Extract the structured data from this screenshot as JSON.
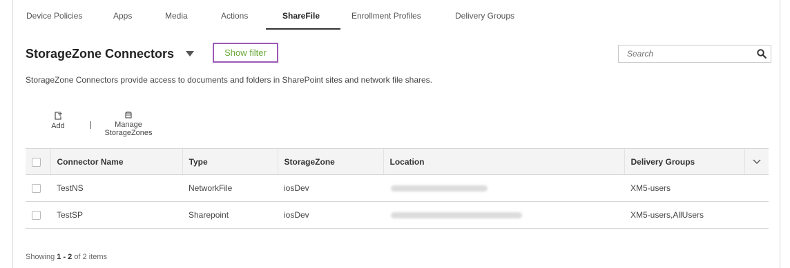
{
  "tabs": [
    {
      "label": "Device Policies",
      "active": false
    },
    {
      "label": "Apps",
      "active": false
    },
    {
      "label": "Media",
      "active": false
    },
    {
      "label": "Actions",
      "active": false
    },
    {
      "label": "ShareFile",
      "active": true
    },
    {
      "label": "Enrollment Profiles",
      "active": false
    },
    {
      "label": "Delivery Groups",
      "active": false
    }
  ],
  "header": {
    "title": "StorageZone Connectors",
    "show_filter_label": "Show filter",
    "search_placeholder": "Search"
  },
  "description": "StorageZone Connectors provide access to documents and folders in SharePoint sites and network file shares.",
  "toolbar": {
    "add_label": "Add",
    "manage_label_line1": "Manage",
    "manage_label_line2": "StorageZones"
  },
  "table": {
    "columns": [
      "Connector Name",
      "Type",
      "StorageZone",
      "Location",
      "Delivery Groups"
    ],
    "rows": [
      {
        "name": "TestNS",
        "type": "NetworkFile",
        "storagezone": "iosDev",
        "location": "",
        "delivery_groups": "XM5-users"
      },
      {
        "name": "TestSP",
        "type": "Sharepoint",
        "storagezone": "iosDev",
        "location": "",
        "delivery_groups": "XM5-users,AllUsers"
      }
    ]
  },
  "footer": {
    "prefix": "Showing",
    "range": "1 - 2",
    "middle": "of",
    "total": "2",
    "suffix": "items"
  },
  "colors": {
    "accent_green": "#6aaa3a",
    "highlight_purple": "#9b59b6"
  }
}
